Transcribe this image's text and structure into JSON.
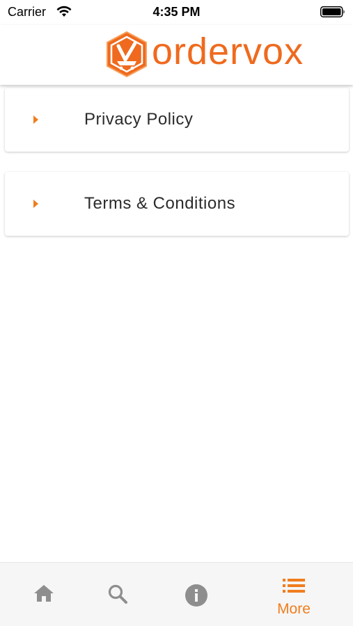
{
  "status_bar": {
    "carrier": "Carrier",
    "time": "4:35 PM"
  },
  "header": {
    "logo_text": "ordervox",
    "brand_color": "#EF6A1E"
  },
  "menu": {
    "items": [
      {
        "label": "Privacy Policy",
        "icon": "caret-right-icon"
      },
      {
        "label": "Terms & Conditions",
        "icon": "caret-right-icon"
      }
    ]
  },
  "tabbar": {
    "tabs": [
      {
        "icon": "home-icon",
        "label": "",
        "active": false
      },
      {
        "icon": "search-icon",
        "label": "",
        "active": false
      },
      {
        "icon": "info-icon",
        "label": "",
        "active": false
      },
      {
        "icon": "list-icon",
        "label": "More",
        "active": true
      }
    ],
    "active_color": "#F07D1E",
    "inactive_color": "#8E8E8E"
  }
}
